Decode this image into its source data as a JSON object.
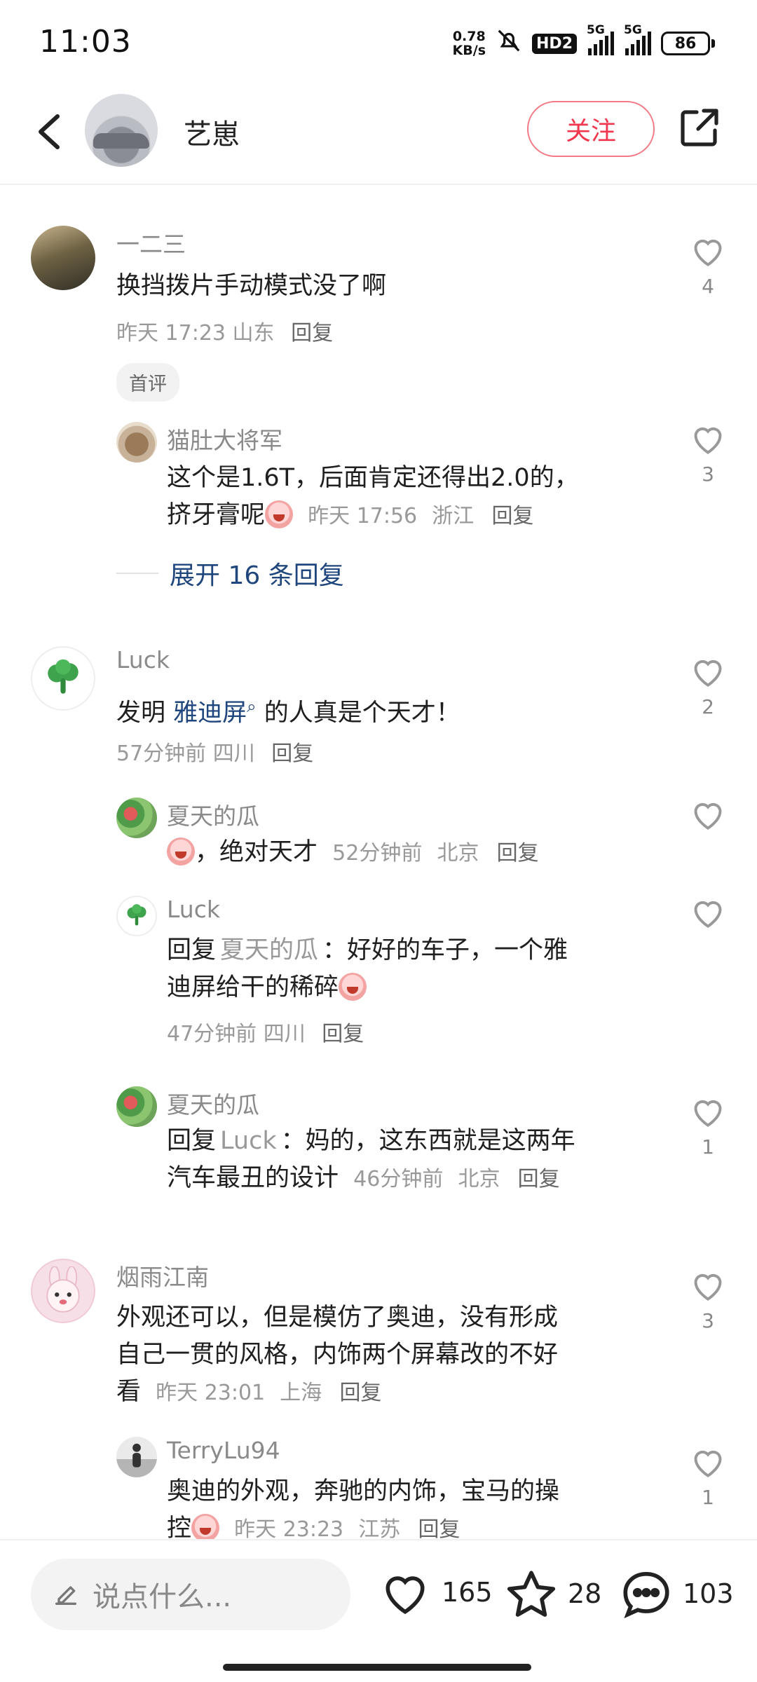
{
  "status_bar": {
    "time": "11:03",
    "net_speed_value": "0.78",
    "net_speed_unit": "KB/s",
    "hd_badge": "HD2",
    "sim1_label": "5G",
    "sim2_label": "5G",
    "battery": "86"
  },
  "header": {
    "author_name": "艺崽",
    "follow_label": "关注"
  },
  "comments": [
    {
      "user": "一二三",
      "text": "换挡拨片手动模式没了啊",
      "time": "昨天 17:23",
      "location": "山东",
      "reply_label": "回复",
      "likes": "4",
      "badge": "首评",
      "replies": [
        {
          "user": "猫肚大将军",
          "text_line1": "这个是1.6T，后面肯定还得出2.0的，",
          "text_line2": "挤牙膏呢",
          "time": "昨天 17:56",
          "location": "浙江",
          "reply_label": "回复",
          "likes": "3"
        }
      ],
      "expand_label": "展开 16 条回复"
    },
    {
      "user": "Luck",
      "text_prefix": "发明 ",
      "text_link": "雅迪屏",
      "text_suffix": " 的人真是个天才！",
      "time": "57分钟前",
      "location": "四川",
      "reply_label": "回复",
      "likes": "2",
      "replies": [
        {
          "user": "夏天的瓜",
          "text": "，绝对天才",
          "time": "52分钟前",
          "location": "北京",
          "reply_label": "回复"
        },
        {
          "user": "Luck",
          "reply_prefix": "回复",
          "reply_to": "夏天的瓜",
          "text_line1": "：好好的车子，一个雅",
          "text_line2": "迪屏给干的稀碎",
          "time": "47分钟前",
          "location": "四川",
          "reply_label": "回复"
        },
        {
          "user": "夏天的瓜",
          "reply_prefix": "回复",
          "reply_to": "Luck",
          "text_line1": "：妈的，这东西就是这两年",
          "text_line2": "汽车最丑的设计",
          "time": "46分钟前",
          "location": "北京",
          "reply_label": "回复",
          "likes": "1"
        }
      ]
    },
    {
      "user": "烟雨江南",
      "text_line1": "外观还可以，但是模仿了奥迪，没有形成",
      "text_line2": "自己一贯的风格，内饰两个屏幕改的不好",
      "text_line3": "看",
      "time": "昨天 23:01",
      "location": "上海",
      "reply_label": "回复",
      "likes": "3",
      "replies": [
        {
          "user": "TerryLu94",
          "text_line1": "奥迪的外观，奔驰的内饰，宝马的操",
          "text_line2": "控",
          "time": "昨天 23:23",
          "location": "江苏",
          "reply_label": "回复",
          "likes": "1"
        }
      ]
    }
  ],
  "bottom_bar": {
    "input_placeholder": "说点什么...",
    "like_count": "165",
    "favorite_count": "28",
    "comment_count": "103"
  },
  "colors": {
    "accent_red": "#f0374e",
    "link_blue": "#20477d",
    "muted_gray": "#999999"
  },
  "icons": [
    "back-arrow-icon",
    "share-icon",
    "heart-icon",
    "star-icon",
    "comment-bubble-icon",
    "pencil-icon",
    "mute-bell-icon",
    "signal-icon",
    "battery-icon",
    "search-icon"
  ]
}
